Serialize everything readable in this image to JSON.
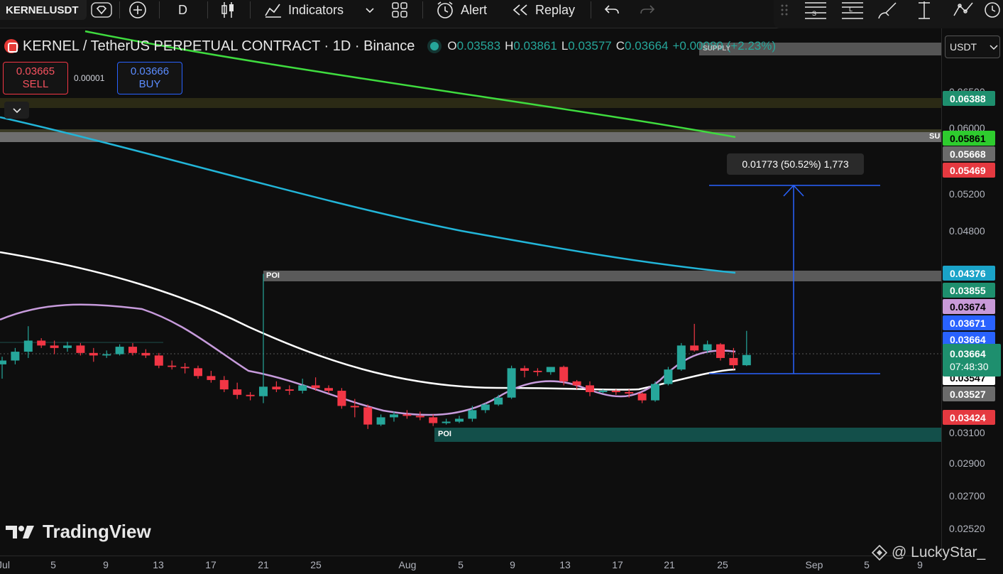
{
  "toolbar": {
    "symbol": "KERNELUSDT",
    "interval": "D",
    "indicators_label": "Indicators",
    "alert_label": "Alert",
    "replay_label": "Replay"
  },
  "legend": {
    "title": "KERNEL / TetherUS PERPETUAL CONTRACT · 1D · Binance",
    "open_key": "O",
    "open": "0.03583",
    "high_key": "H",
    "high": "0.03861",
    "low_key": "L",
    "low": "0.03577",
    "close_key": "C",
    "close": "0.03664",
    "change": "+0.00080 (+2.23%)"
  },
  "trade": {
    "sell_price": "0.03665",
    "sell_label": "SELL",
    "spread": "0.00001",
    "buy_price": "0.03666",
    "buy_label": "BUY"
  },
  "measure": {
    "label": "0.01773 (50.52%) 1,773"
  },
  "zones": {
    "poi_label": "POI",
    "supply_label": "SUPPLY",
    "su_label": "SU"
  },
  "price_axis": {
    "currency": "USDT",
    "ticks": [
      "0.06500",
      "0.06000",
      "0.05200",
      "0.04800",
      "0.03100",
      "0.02900",
      "0.02700",
      "0.02520"
    ],
    "badges": [
      {
        "value": "0.06388",
        "bg": "#1e8f6e",
        "fg": "#ffffff"
      },
      {
        "value": "0.05861",
        "bg": "#2ecc2e",
        "fg": "#000000"
      },
      {
        "value": "0.05668",
        "bg": "#6b6b6b",
        "fg": "#ffffff"
      },
      {
        "value": "0.05469",
        "bg": "#e53940",
        "fg": "#ffffff"
      },
      {
        "value": "0.04376",
        "bg": "#1aa3c8",
        "fg": "#ffffff"
      },
      {
        "value": "0.03855",
        "bg": "#1e8f6e",
        "fg": "#ffffff"
      },
      {
        "value": "0.03674",
        "bg": "#c89ad8",
        "fg": "#000000"
      },
      {
        "value": "0.03671",
        "bg": "#2962ff",
        "fg": "#ffffff"
      },
      {
        "value": "0.03664",
        "bg": "#2962ff",
        "fg": "#ffffff"
      },
      {
        "value": "0.03547",
        "bg": "#ffffff",
        "fg": "#000000"
      },
      {
        "value": "0.03527",
        "bg": "#6b6b6b",
        "fg": "#ffffff"
      },
      {
        "value": "0.03424",
        "bg": "#e53940",
        "fg": "#ffffff"
      }
    ],
    "last_price": "0.03664",
    "countdown": "07:48:30"
  },
  "time_axis": {
    "labels": [
      "Jul",
      "5",
      "9",
      "13",
      "17",
      "21",
      "25",
      "Aug",
      "5",
      "9",
      "13",
      "17",
      "21",
      "25",
      "Sep",
      "5",
      "9"
    ]
  },
  "branding": {
    "logo": "TradingView",
    "watermark": "@ LuckyStar_"
  },
  "colors": {
    "up": "#26a69a",
    "down": "#f23645",
    "ma_white": "#ffffff",
    "ma_pink": "#c79bdc",
    "ma_cyan": "#22b5d8",
    "ma_green": "#3fdc3f"
  },
  "chart_data": {
    "type": "candlestick",
    "candles": [
      {
        "o": 0.0359,
        "h": 0.0365,
        "l": 0.0348,
        "c": 0.0362
      },
      {
        "o": 0.0362,
        "h": 0.0372,
        "l": 0.0359,
        "c": 0.0369
      },
      {
        "o": 0.0369,
        "h": 0.039,
        "l": 0.0364,
        "c": 0.0378
      },
      {
        "o": 0.0378,
        "h": 0.038,
        "l": 0.0372,
        "c": 0.0374
      },
      {
        "o": 0.0374,
        "h": 0.0378,
        "l": 0.0367,
        "c": 0.0372
      },
      {
        "o": 0.0372,
        "h": 0.0377,
        "l": 0.0369,
        "c": 0.0374
      },
      {
        "o": 0.0374,
        "h": 0.0376,
        "l": 0.0366,
        "c": 0.0368
      },
      {
        "o": 0.0368,
        "h": 0.0372,
        "l": 0.0361,
        "c": 0.0366
      },
      {
        "o": 0.0366,
        "h": 0.037,
        "l": 0.0364,
        "c": 0.0367
      },
      {
        "o": 0.0367,
        "h": 0.0375,
        "l": 0.0366,
        "c": 0.0373
      },
      {
        "o": 0.0373,
        "h": 0.0376,
        "l": 0.0366,
        "c": 0.0368
      },
      {
        "o": 0.0368,
        "h": 0.0371,
        "l": 0.0364,
        "c": 0.0366
      },
      {
        "o": 0.0366,
        "h": 0.0368,
        "l": 0.0356,
        "c": 0.0358
      },
      {
        "o": 0.0358,
        "h": 0.0362,
        "l": 0.0355,
        "c": 0.0357
      },
      {
        "o": 0.0357,
        "h": 0.036,
        "l": 0.0352,
        "c": 0.0356
      },
      {
        "o": 0.0356,
        "h": 0.0358,
        "l": 0.0348,
        "c": 0.035
      },
      {
        "o": 0.035,
        "h": 0.0354,
        "l": 0.0345,
        "c": 0.0347
      },
      {
        "o": 0.0347,
        "h": 0.035,
        "l": 0.0338,
        "c": 0.034
      },
      {
        "o": 0.034,
        "h": 0.0345,
        "l": 0.0333,
        "c": 0.0336
      },
      {
        "o": 0.0336,
        "h": 0.0338,
        "l": 0.0332,
        "c": 0.0335
      },
      {
        "o": 0.0335,
        "h": 0.0437,
        "l": 0.033,
        "c": 0.0342
      },
      {
        "o": 0.0342,
        "h": 0.0346,
        "l": 0.0338,
        "c": 0.034
      },
      {
        "o": 0.034,
        "h": 0.0343,
        "l": 0.0336,
        "c": 0.0339
      },
      {
        "o": 0.0339,
        "h": 0.0348,
        "l": 0.0337,
        "c": 0.0343
      },
      {
        "o": 0.0343,
        "h": 0.0349,
        "l": 0.0339,
        "c": 0.0341
      },
      {
        "o": 0.0341,
        "h": 0.0343,
        "l": 0.0337,
        "c": 0.0339
      },
      {
        "o": 0.0339,
        "h": 0.0341,
        "l": 0.0326,
        "c": 0.0328
      },
      {
        "o": 0.0328,
        "h": 0.0333,
        "l": 0.032,
        "c": 0.0327
      },
      {
        "o": 0.0327,
        "h": 0.0329,
        "l": 0.0312,
        "c": 0.0315
      },
      {
        "o": 0.0315,
        "h": 0.0322,
        "l": 0.0314,
        "c": 0.032
      },
      {
        "o": 0.032,
        "h": 0.0324,
        "l": 0.0317,
        "c": 0.0322
      },
      {
        "o": 0.0322,
        "h": 0.0325,
        "l": 0.0319,
        "c": 0.0321
      },
      {
        "o": 0.0321,
        "h": 0.0324,
        "l": 0.0318,
        "c": 0.032
      },
      {
        "o": 0.032,
        "h": 0.0322,
        "l": 0.0314,
        "c": 0.0316
      },
      {
        "o": 0.0316,
        "h": 0.0319,
        "l": 0.0315,
        "c": 0.0317
      },
      {
        "o": 0.0317,
        "h": 0.0321,
        "l": 0.0316,
        "c": 0.0319
      },
      {
        "o": 0.0319,
        "h": 0.0328,
        "l": 0.0317,
        "c": 0.0325
      },
      {
        "o": 0.0325,
        "h": 0.033,
        "l": 0.0323,
        "c": 0.0329
      },
      {
        "o": 0.0329,
        "h": 0.0336,
        "l": 0.0328,
        "c": 0.0334
      },
      {
        "o": 0.0334,
        "h": 0.0358,
        "l": 0.0333,
        "c": 0.0356
      },
      {
        "o": 0.0356,
        "h": 0.0358,
        "l": 0.0349,
        "c": 0.0354
      },
      {
        "o": 0.0354,
        "h": 0.0356,
        "l": 0.035,
        "c": 0.0353
      },
      {
        "o": 0.0353,
        "h": 0.0357,
        "l": 0.0351,
        "c": 0.0357
      },
      {
        "o": 0.0357,
        "h": 0.0358,
        "l": 0.0343,
        "c": 0.0346
      },
      {
        "o": 0.0346,
        "h": 0.0347,
        "l": 0.034,
        "c": 0.0343
      },
      {
        "o": 0.0343,
        "h": 0.0346,
        "l": 0.0335,
        "c": 0.0338
      },
      {
        "o": 0.0338,
        "h": 0.034,
        "l": 0.0337,
        "c": 0.0339
      },
      {
        "o": 0.0339,
        "h": 0.034,
        "l": 0.0336,
        "c": 0.0338
      },
      {
        "o": 0.0338,
        "h": 0.034,
        "l": 0.0334,
        "c": 0.0337
      },
      {
        "o": 0.0337,
        "h": 0.0338,
        "l": 0.033,
        "c": 0.0332
      },
      {
        "o": 0.0332,
        "h": 0.0346,
        "l": 0.0331,
        "c": 0.0344
      },
      {
        "o": 0.0344,
        "h": 0.0357,
        "l": 0.0343,
        "c": 0.0355
      },
      {
        "o": 0.0355,
        "h": 0.0376,
        "l": 0.0354,
        "c": 0.0374
      },
      {
        "o": 0.0374,
        "h": 0.0392,
        "l": 0.0369,
        "c": 0.037
      },
      {
        "o": 0.037,
        "h": 0.0378,
        "l": 0.0368,
        "c": 0.0375
      },
      {
        "o": 0.0375,
        "h": 0.0376,
        "l": 0.0362,
        "c": 0.0364
      },
      {
        "o": 0.0364,
        "h": 0.0372,
        "l": 0.0355,
        "c": 0.03583
      },
      {
        "o": 0.03583,
        "h": 0.03861,
        "l": 0.03577,
        "c": 0.03664
      }
    ],
    "start_index": 0,
    "visible_from_index": 0,
    "ylim": [
      0.0245,
      0.07
    ]
  }
}
